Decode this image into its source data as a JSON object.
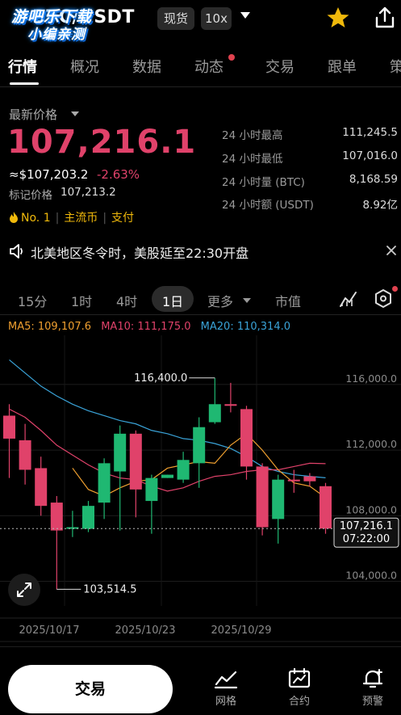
{
  "header": {
    "pair_title": "BTC/USDT",
    "watermark_line1": "游吧乐下载",
    "watermark_line2": "小编亲测",
    "market_type": "现货",
    "leverage": "10x",
    "favorite_icon": "star-icon",
    "share_icon": "share-icon"
  },
  "tabs": [
    {
      "label": "行情",
      "active": true
    },
    {
      "label": "概况"
    },
    {
      "label": "数据"
    },
    {
      "label": "动态",
      "has_dot": true
    },
    {
      "label": "交易"
    },
    {
      "label": "跟单"
    },
    {
      "label": "策"
    }
  ],
  "price": {
    "latest_label": "最新价格",
    "last_price": "107,216.1",
    "usd_price": "≈$107,203.2",
    "change_pct": "-2.63%",
    "mark_label": "标记价格",
    "mark_price": "107,213.2",
    "badges": [
      "No. 1",
      "主流币",
      "支付"
    ]
  },
  "stats": [
    {
      "label": "24 小时最高",
      "value": "111,245.5"
    },
    {
      "label": "24 小时最低",
      "value": "107,016.0"
    },
    {
      "label": "24 小时量 (BTC)",
      "value": "8,168.59"
    },
    {
      "label": "24 小时额 (USDT)",
      "value": "8.92亿"
    }
  ],
  "notice": {
    "text": "北美地区冬令时，美股延至22:30开盘"
  },
  "intervals": [
    {
      "label": "15分"
    },
    {
      "label": "1时"
    },
    {
      "label": "4时"
    },
    {
      "label": "1日",
      "active": true
    },
    {
      "label": "更多"
    },
    {
      "label": "市值"
    }
  ],
  "ma": {
    "ma5": "MA5: 109,107.6",
    "ma10": "MA10: 111,175.0",
    "ma20": "MA20: 110,314.0"
  },
  "colors": {
    "up": "#1fb872",
    "down": "#e0426a",
    "ma5": "#f0a030",
    "ma10": "#e0426a",
    "ma20": "#3aa3d8"
  },
  "chart_data": {
    "type": "candlestick",
    "ylim": [
      102500,
      119000
    ],
    "y_ticks": [
      "116,000.0",
      "112,000.0",
      "108,000.0",
      "104,000.0"
    ],
    "x_ticks": [
      "2025/10/17",
      "2025/10/23",
      "2025/10/29"
    ],
    "high_marker": "116,400.0",
    "low_marker": "103,514.5",
    "current_price": "107,216.1",
    "current_time": "07:22:00",
    "candles": [
      {
        "o": 114100,
        "h": 114800,
        "c": 112700,
        "l": 110300
      },
      {
        "o": 112600,
        "h": 113600,
        "c": 110800,
        "l": 109900
      },
      {
        "o": 110900,
        "h": 111600,
        "c": 108600,
        "l": 108000
      },
      {
        "o": 108800,
        "h": 109200,
        "c": 107100,
        "l": 103514.5
      },
      {
        "o": 107200,
        "h": 108300,
        "c": 107300,
        "l": 106700
      },
      {
        "o": 107200,
        "h": 108900,
        "c": 108600,
        "l": 107000
      },
      {
        "o": 108800,
        "h": 111500,
        "c": 111200,
        "l": 107800
      },
      {
        "o": 110700,
        "h": 113500,
        "c": 113000,
        "l": 107100
      },
      {
        "o": 113000,
        "h": 113200,
        "c": 109600,
        "l": 107900
      },
      {
        "o": 108900,
        "h": 110500,
        "c": 110300,
        "l": 106900
      },
      {
        "o": 110300,
        "h": 110500,
        "c": 110500,
        "l": 110300
      },
      {
        "o": 110200,
        "h": 111900,
        "c": 111400,
        "l": 110000
      },
      {
        "o": 111200,
        "h": 114000,
        "c": 113400,
        "l": 109700
      },
      {
        "o": 113700,
        "h": 116400,
        "c": 114800,
        "l": 113600
      },
      {
        "o": 114800,
        "h": 116100,
        "c": 114700,
        "l": 114300
      },
      {
        "o": 114500,
        "h": 114700,
        "c": 111000,
        "l": 110200
      },
      {
        "o": 111000,
        "h": 111200,
        "c": 107300,
        "l": 106800
      },
      {
        "o": 107800,
        "h": 110500,
        "c": 110200,
        "l": 106300
      },
      {
        "o": 110200,
        "h": 110800,
        "c": 110100,
        "l": 109400
      },
      {
        "o": 110400,
        "h": 110600,
        "c": 110100,
        "l": 109800
      },
      {
        "o": 109800,
        "h": 110000,
        "c": 107216.1,
        "l": 106900
      }
    ],
    "ma5": [
      null,
      null,
      null,
      null,
      110900,
      109600,
      109200,
      109700,
      110100,
      110200,
      110900,
      111100,
      111300,
      111200,
      112300,
      113000,
      112000,
      110800,
      110000,
      109800,
      109100
    ],
    "ma10": [
      114500,
      114000,
      113200,
      112300,
      111700,
      111100,
      110600,
      110300,
      110200,
      109800,
      109500,
      109700,
      110100,
      110400,
      110500,
      110700,
      110800,
      110800,
      111000,
      111200,
      111175
    ],
    "ma20": [
      117500,
      116700,
      115900,
      115300,
      114800,
      114400,
      114100,
      113800,
      113600,
      113200,
      113000,
      112700,
      112600,
      112400,
      112100,
      111600,
      111000,
      110700,
      110500,
      110400,
      110314
    ]
  },
  "bottom_bar": {
    "trade_label": "交易",
    "nav": [
      {
        "label": "网格",
        "icon": "grid-strategy-icon"
      },
      {
        "label": "合约",
        "icon": "futures-icon"
      },
      {
        "label": "预警",
        "icon": "alert-bell-icon"
      }
    ]
  }
}
